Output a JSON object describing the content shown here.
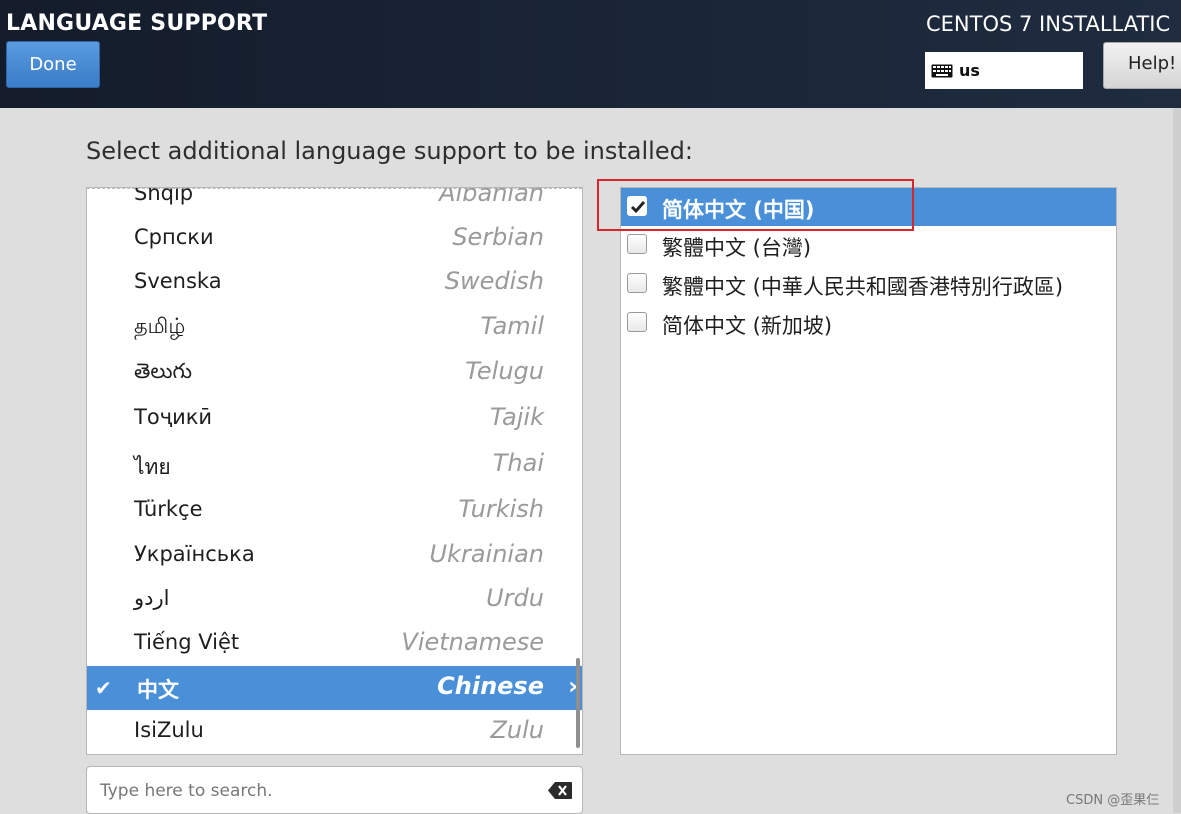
{
  "header": {
    "title": "LANGUAGE SUPPORT",
    "done_label": "Done",
    "product": "CENTOS 7 INSTALLATIC",
    "keyboard_layout": "us",
    "help_label": "Help!"
  },
  "instruction": "Select additional language support to be installed:",
  "languages": [
    {
      "native": "Shqip",
      "english": "Albanian"
    },
    {
      "native": "Српски",
      "english": "Serbian"
    },
    {
      "native": "Svenska",
      "english": "Swedish"
    },
    {
      "native": "தமிழ்",
      "english": "Tamil"
    },
    {
      "native": "తెలుగు",
      "english": "Telugu"
    },
    {
      "native": "Тоҷикӣ",
      "english": "Tajik"
    },
    {
      "native": "ไทย",
      "english": "Thai"
    },
    {
      "native": "Türkçe",
      "english": "Turkish"
    },
    {
      "native": "Українська",
      "english": "Ukrainian"
    },
    {
      "native": "اردو",
      "english": "Urdu"
    },
    {
      "native": "Tiếng Việt",
      "english": "Vietnamese"
    },
    {
      "native": "中文",
      "english": "Chinese",
      "selected": true
    },
    {
      "native": "IsiZulu",
      "english": "Zulu"
    }
  ],
  "selected_check": "✔",
  "selected_arrow": "›",
  "locales": [
    {
      "label": "简体中文 (中国)",
      "checked": true,
      "selected": true
    },
    {
      "label": "繁體中文 (台灣)",
      "checked": false
    },
    {
      "label": "繁體中文 (中華人民共和國香港特別行政區)",
      "checked": false
    },
    {
      "label": "简体中文 (新加坡)",
      "checked": false
    }
  ],
  "search": {
    "placeholder": "Type here to search.",
    "value": ""
  },
  "icons": {
    "keyboard": "keyboard-icon",
    "clear": "backspace-clear-icon",
    "check": "checkmark-icon"
  },
  "colors": {
    "header_bg": "#1a2536",
    "accent": "#4a90d9",
    "highlight": "#d9262d"
  },
  "watermark": "CSDN @歪果仨"
}
